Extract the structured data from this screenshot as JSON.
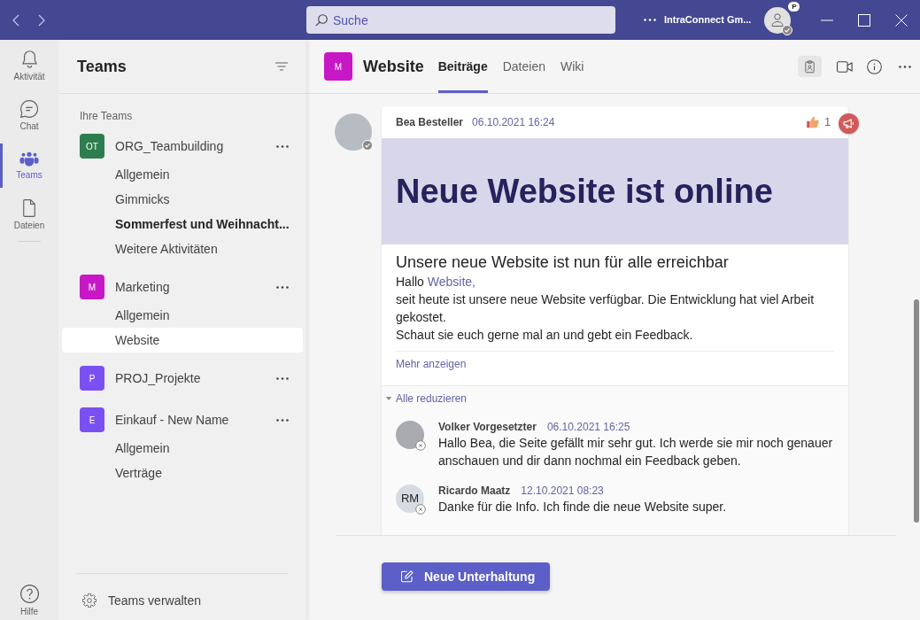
{
  "title_bar": {
    "search": {
      "placeholder": "Suche"
    },
    "account": "IntraConnect Gm...",
    "profile_badge": "P",
    "available": true
  },
  "app_bar": {
    "items": [
      {
        "kind": "bell",
        "label": "Aktivität",
        "selected": false
      },
      {
        "kind": "chat",
        "label": "Chat",
        "selected": false
      },
      {
        "kind": "teams",
        "label": "Teams",
        "selected": true
      },
      {
        "kind": "file",
        "label": "Dateien",
        "selected": false
      }
    ],
    "help": "Hilfe"
  },
  "teams_panel": {
    "title": "Teams",
    "section_label": "Ihre Teams",
    "teams": [
      {
        "initials": "OT",
        "name": "ORG_Teambuilding",
        "color": "#2e7d4f",
        "channels": [
          {
            "name": "Allgemein",
            "selected": false,
            "unread": false
          },
          {
            "name": "Gimmicks",
            "selected": false,
            "unread": false
          },
          {
            "name": "Sommerfest und Weihnacht...",
            "selected": false,
            "unread": true
          },
          {
            "name": "Weitere Aktivitäten",
            "selected": false,
            "unread": false
          }
        ]
      },
      {
        "initials": "M",
        "name": "Marketing",
        "color": "#c817c6",
        "channels": [
          {
            "name": "Allgemein",
            "selected": false,
            "unread": false
          },
          {
            "name": "Website",
            "selected": true,
            "unread": false
          }
        ]
      },
      {
        "initials": "P",
        "name": "PROJ_Projekte",
        "color": "#7b50f2"
      },
      {
        "initials": "E",
        "name": "Einkauf - New Name",
        "color": "#7b50f2",
        "channels": [
          {
            "name": "Allgemein",
            "selected": false,
            "unread": false
          },
          {
            "name": "Verträge",
            "selected": false,
            "unread": false
          }
        ]
      }
    ],
    "manage": "Teams verwalten"
  },
  "channel": {
    "initials": "M",
    "name": "Website",
    "tabs": [
      {
        "label": "Beiträge",
        "selected": true
      },
      {
        "label": "Dateien",
        "selected": false
      },
      {
        "label": "Wiki",
        "selected": false
      }
    ]
  },
  "post": {
    "author": "Bea Besteller",
    "time": "06.10.2021 16:24",
    "available": true,
    "reaction_count": "1",
    "banner_title": "Neue Website ist online",
    "subtitle": "Unsere neue Website ist nun für alle erreichbar",
    "greeting": "Hallo",
    "mention": "Website,",
    "paragraphs": [
      "seit heute ist unsere neue Website verfügbar. Die Entwicklung hat viel Arbeit gekostet.",
      "Schaut sie euch gerne mal an und gebt ein Feedback."
    ],
    "show_more": "Mehr anzeigen",
    "collapse": "Alle reduzieren",
    "replies": [
      {
        "kind": "photo",
        "author": "Volker Vorgesetzter",
        "time": "06.10.2021 16:25",
        "available": false,
        "text": "Hallo Bea, die Seite gefällt mir sehr gut. Ich werde sie mir noch genauer anschauen und dir dann nochmal ein Feedback geben."
      },
      {
        "kind": "initials",
        "initials": "RM",
        "author": "Ricardo Maatz",
        "time": "12.10.2021 08:23",
        "available": false,
        "text": "Danke für die Info. Ich finde die neue Website super."
      }
    ]
  },
  "new_conversation": "Neue Unterhaltung"
}
